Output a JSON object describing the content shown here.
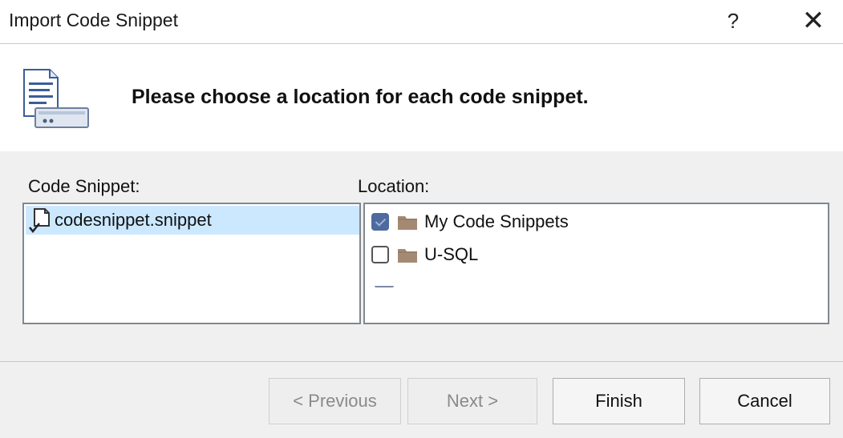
{
  "window": {
    "title": "Import Code Snippet",
    "help_label": "?",
    "close_label": "✕"
  },
  "header": {
    "text": "Please choose a location for each code snippet."
  },
  "snippets": {
    "label": "Code Snippet:",
    "items": [
      {
        "name": "codesnippet.snippet",
        "selected": true
      }
    ]
  },
  "locations": {
    "label": "Location:",
    "items": [
      {
        "name": "My Code Snippets",
        "checked": true
      },
      {
        "name": "U-SQL",
        "checked": false
      }
    ]
  },
  "buttons": {
    "previous": "< Previous",
    "next": "Next >",
    "finish": "Finish",
    "cancel": "Cancel"
  },
  "colors": {
    "selection": "#cce8ff",
    "checkbox_checked": "#4e6a9e",
    "folder": "#a58a73"
  }
}
